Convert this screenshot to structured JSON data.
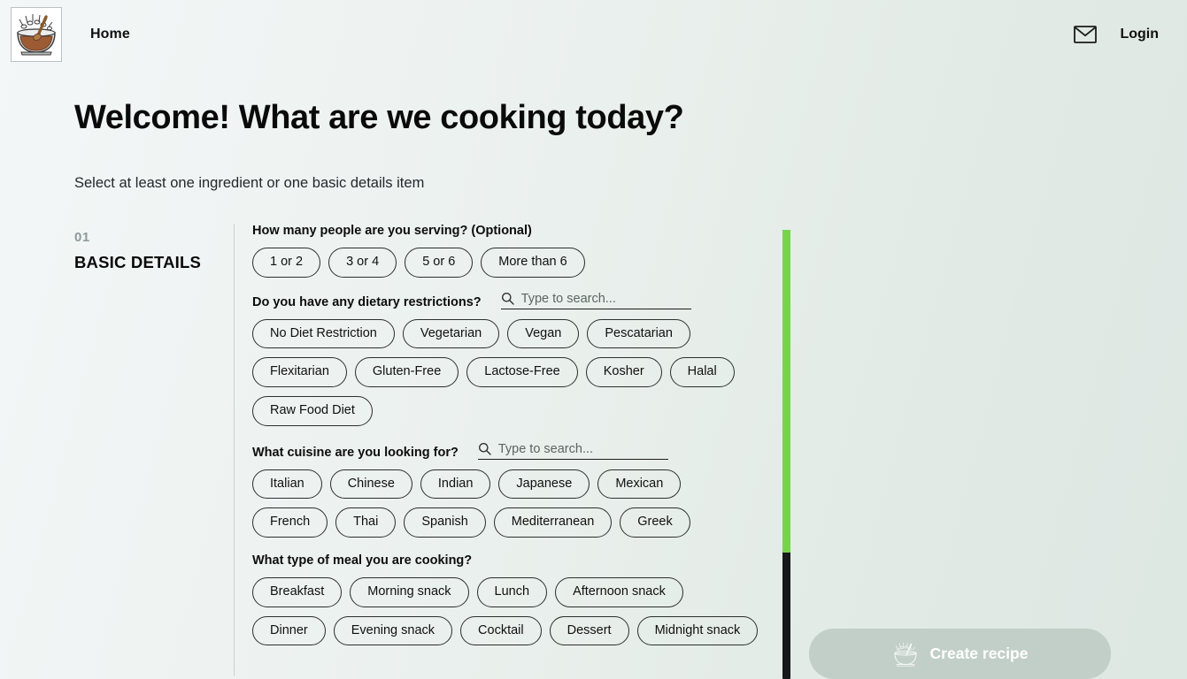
{
  "header": {
    "logo_icon": "salad-bowl-logo-icon",
    "home_label": "Home",
    "mail_icon": "mail-envelope-icon",
    "login_label": "Login"
  },
  "page": {
    "title": "Welcome! What are we cooking today?",
    "subtitle": "Select at least one ingredient or one basic details item"
  },
  "step": {
    "number": "01",
    "label": "BASIC DETAILS"
  },
  "questions": [
    {
      "id": "serving-size",
      "label": "How many people are you serving? (Optional)",
      "has_search": false,
      "options": [
        "1 or 2",
        "3 or 4",
        "5 or 6",
        "More than 6"
      ]
    },
    {
      "id": "dietary-restrictions",
      "label": "Do you have any dietary restrictions?",
      "has_search": true,
      "search_placeholder": "Type to search...",
      "search_value": "",
      "search_icon": "search-icon",
      "options": [
        "No Diet Restriction",
        "Vegetarian",
        "Vegan",
        "Pescatarian",
        "Flexitarian",
        "Gluten-Free",
        "Lactose-Free",
        "Kosher",
        "Halal",
        "Raw Food Diet"
      ]
    },
    {
      "id": "cuisine",
      "label": "What cuisine are you looking for?",
      "has_search": true,
      "search_placeholder": "Type to search...",
      "search_value": "",
      "search_icon": "search-icon",
      "options": [
        "Italian",
        "Chinese",
        "Indian",
        "Japanese",
        "Mexican",
        "French",
        "Thai",
        "Spanish",
        "Mediterranean",
        "Greek"
      ]
    },
    {
      "id": "meal-type",
      "label": "What type of meal you are cooking?",
      "has_search": false,
      "options": [
        "Breakfast",
        "Morning snack",
        "Lunch",
        "Afternoon snack",
        "Dinner",
        "Evening snack",
        "Cocktail",
        "Dessert",
        "Midnight snack"
      ]
    }
  ],
  "progress": {
    "fill_percent": 72,
    "fill_color": "#76d44b",
    "track_color": "#16181a"
  },
  "cta": {
    "label": "Create recipe",
    "icon": "salad-bowl-icon",
    "disabled": true,
    "background": "#c2cfc8",
    "text_color": "#ffffff"
  }
}
